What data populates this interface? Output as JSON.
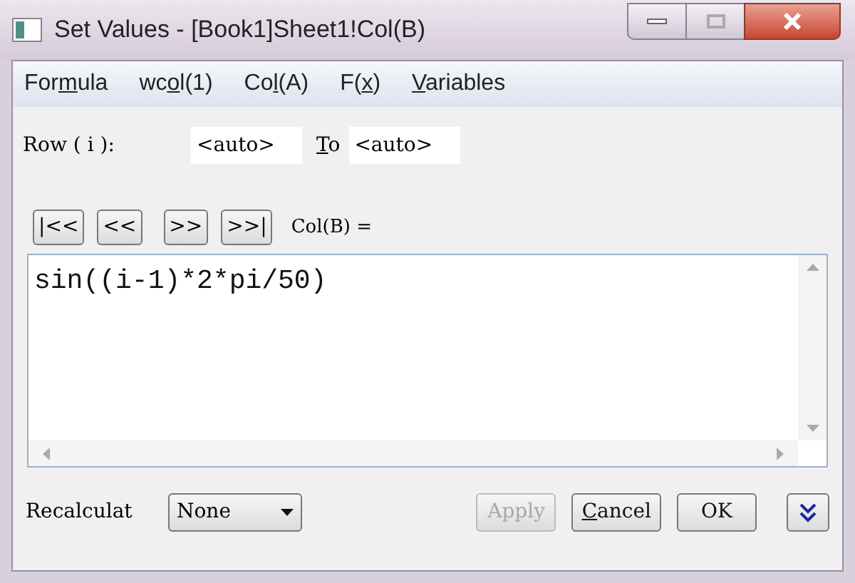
{
  "window": {
    "title": "Set Values - [Book1]Sheet1!Col(B)"
  },
  "menu": [
    {
      "before": "For",
      "key": "m",
      "after": "ula"
    },
    {
      "before": "wc",
      "key": "o",
      "after": "l(1)"
    },
    {
      "before": "Co",
      "key": "l",
      "after": "(A)"
    },
    {
      "before": "F(",
      "key": "x",
      "after": ")"
    },
    {
      "key": "V",
      "after": "ariables"
    }
  ],
  "row_range": {
    "label": "Row ( i ):",
    "from": "<auto>",
    "to_label": {
      "key": "T",
      "after": "o"
    },
    "to": "<auto>"
  },
  "nav_buttons": [
    "|<<",
    "<<",
    ">>",
    ">>|"
  ],
  "formula_label": "Col(B) =",
  "formula": "sin((i-1)*2*pi/50)",
  "recalculate": {
    "label": "Recalculat",
    "value": "None"
  },
  "buttons": [
    {
      "after": "Apply",
      "disabled": true
    },
    {
      "key": "C",
      "after": "ancel",
      "disabled": false
    },
    {
      "after": "OK",
      "disabled": false
    }
  ]
}
